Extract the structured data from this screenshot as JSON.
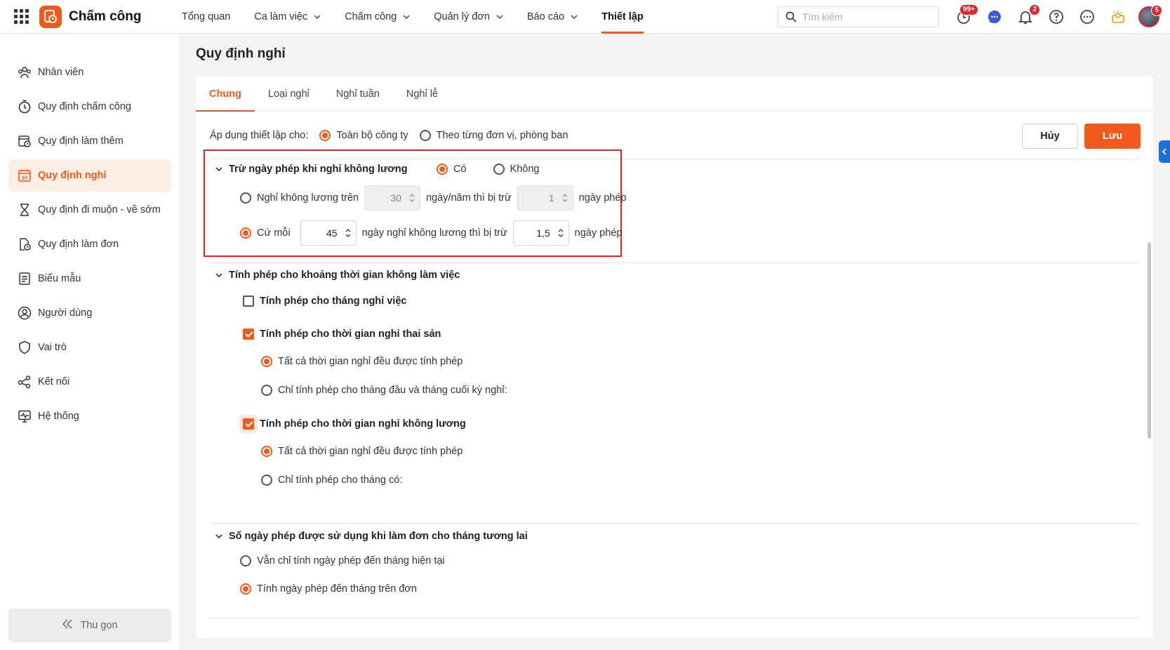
{
  "app": {
    "title": "Chấm công"
  },
  "nav": [
    {
      "label": "Tổng quan",
      "dropdown": false,
      "active": false
    },
    {
      "label": "Ca làm việc",
      "dropdown": true,
      "active": false
    },
    {
      "label": "Chấm công",
      "dropdown": true,
      "active": false
    },
    {
      "label": "Quản lý đơn",
      "dropdown": true,
      "active": false
    },
    {
      "label": "Báo cáo",
      "dropdown": true,
      "active": false
    },
    {
      "label": "Thiết lập",
      "dropdown": false,
      "active": true
    }
  ],
  "search": {
    "placeholder": "Tìm kiếm"
  },
  "badges": {
    "timer": "99+",
    "bell": "2",
    "avatar": "5"
  },
  "colors": {
    "accent": "#f05a1a",
    "highlight": "#e3242b",
    "badge": "#e3242b",
    "chat": "#3b5bdb"
  },
  "sidebar": {
    "items": [
      {
        "label": "Nhân viên",
        "icon": "users-icon",
        "active": false
      },
      {
        "label": "Quy định chấm công",
        "icon": "stopwatch-icon",
        "active": false
      },
      {
        "label": "Quy định làm thêm",
        "icon": "calendar-clock-icon",
        "active": false
      },
      {
        "label": "Quy định nghỉ",
        "icon": "calendar-10-icon",
        "active": true
      },
      {
        "label": "Quy định đi muộn - về sớm",
        "icon": "hourglass-icon",
        "active": false
      },
      {
        "label": "Quy định làm đơn",
        "icon": "document-clock-icon",
        "active": false
      },
      {
        "label": "Biểu mẫu",
        "icon": "form-icon",
        "active": false
      },
      {
        "label": "Người dùng",
        "icon": "user-circle-icon",
        "active": false
      },
      {
        "label": "Vai trò",
        "icon": "shield-icon",
        "active": false
      },
      {
        "label": "Kết nối",
        "icon": "share-icon",
        "active": false
      },
      {
        "label": "Hệ thống",
        "icon": "monitor-pulse-icon",
        "active": false
      }
    ],
    "collapse_label": "Thu gọn"
  },
  "page": {
    "title": "Quy định nghỉ",
    "tabs": [
      "Chung",
      "Loại nghỉ",
      "Nghỉ tuần",
      "Nghỉ lễ"
    ],
    "active_tab": "Chung",
    "apply": {
      "label": "Áp dụng thiết lập cho:",
      "options": [
        "Toàn bộ công ty",
        "Theo từng đơn vị, phòng ban"
      ],
      "selected": "Toàn bộ công ty"
    },
    "buttons": {
      "cancel": "Hủy",
      "save": "Lưu"
    },
    "section1": {
      "title": "Trừ ngày phép khi nghỉ không lương",
      "yes": "Có",
      "no": "Không",
      "selected": "Có",
      "opt1": {
        "prefix": "Nghỉ không lương trên",
        "value1": "30",
        "middle": "ngày/năm thì bị trừ",
        "value2": "1",
        "suffix": "ngày phép",
        "selected": false
      },
      "opt2": {
        "prefix": "Cứ mỗi",
        "value1": "45",
        "middle": "ngày nghỉ không lương thì bị trừ",
        "value2": "1,5",
        "suffix": "ngày phép",
        "selected": true
      }
    },
    "section2": {
      "title": "Tính phép cho khoảng thời gian không làm việc",
      "c1": {
        "label": "Tính phép cho tháng nghỉ việc",
        "checked": false
      },
      "c2": {
        "label": "Tính phép cho thời gian nghỉ thai sản",
        "checked": true,
        "opt_a": "Tất cả thời gian nghỉ đều được tính phép",
        "opt_b": "Chỉ tính phép cho tháng đầu và tháng cuối kỳ nghỉ:",
        "selected": "a"
      },
      "c3": {
        "label": "Tính phép cho thời gian nghỉ không lương",
        "checked": true,
        "opt_a": "Tất cả thời gian nghỉ đều được tính phép",
        "opt_b": "Chỉ tính phép cho tháng có:",
        "selected": "a"
      }
    },
    "section3": {
      "title": "Số ngày phép được sử dụng khi làm đơn cho tháng tương lai",
      "opt_a": "Vẫn chỉ tính ngày phép đến tháng hiện tại",
      "opt_b": "Tính ngày phép đến tháng trên đơn",
      "selected": "b"
    }
  }
}
